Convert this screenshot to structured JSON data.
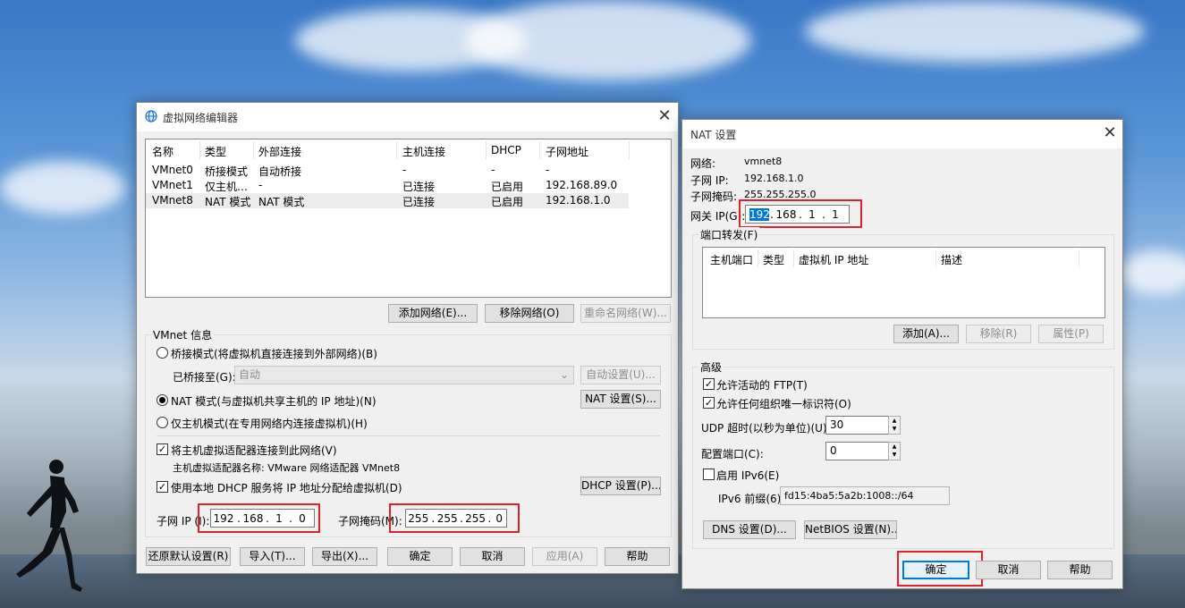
{
  "vne": {
    "title": "虚拟网络编辑器",
    "columns": [
      "名称",
      "类型",
      "外部连接",
      "主机连接",
      "DHCP",
      "子网地址"
    ],
    "rows": [
      [
        "VMnet0",
        "桥接模式",
        "自动桥接",
        "-",
        "-",
        "-"
      ],
      [
        "VMnet1",
        "仅主机…",
        "-",
        "已连接",
        "已启用",
        "192.168.89.0"
      ],
      [
        "VMnet8",
        "NAT 模式",
        "NAT 模式",
        "已连接",
        "已启用",
        "192.168.1.0"
      ]
    ],
    "add_network": "添加网络(E)...",
    "remove_network": "移除网络(O)",
    "rename_network": "重命名网络(W)...",
    "vmnet_info": "VMnet 信息",
    "bridged_mode": "桥接模式(将虚拟机直接连接到外部网络)(B)",
    "bridged_to_label": "已桥接至(G):",
    "bridged_to_value": "自动",
    "auto_settings": "自动设置(U)...",
    "nat_mode": "NAT 模式(与虚拟机共享主机的 IP 地址)(N)",
    "nat_settings": "NAT 设置(S)...",
    "host_only_mode": "仅主机模式(在专用网络内连接虚拟机)(H)",
    "connect_adapter": "将主机虚拟适配器连接到此网络(V)",
    "adapter_name": "主机虚拟适配器名称: VMware 网络适配器 VMnet8",
    "use_dhcp": "使用本地 DHCP 服务将 IP 地址分配给虚拟机(D)",
    "dhcp_settings": "DHCP 设置(P)...",
    "subnet_ip_label": "子网 IP (I):",
    "subnet_ip": [
      "192",
      "168",
      "1",
      "0"
    ],
    "subnet_mask_label": "子网掩码(M):",
    "subnet_mask": [
      "255",
      "255",
      "255",
      "0"
    ],
    "restore_defaults": "还原默认设置(R)",
    "import": "导入(T)...",
    "export": "导出(X)...",
    "ok": "确定",
    "cancel": "取消",
    "apply": "应用(A)",
    "help": "帮助"
  },
  "nat": {
    "title": "NAT 设置",
    "network_label": "网络:",
    "network_value": "vmnet8",
    "subnet_ip_label": "子网 IP:",
    "subnet_ip_value": "192.168.1.0",
    "subnet_mask_label": "子网掩码:",
    "subnet_mask_value": "255.255.255.0",
    "gateway_label": "网关 IP(G):",
    "gateway": [
      "192",
      "168",
      "1",
      "1"
    ],
    "port_forwarding": "端口转发(F)",
    "pf_columns": [
      "主机端口",
      "类型",
      "虚拟机 IP 地址",
      "描述"
    ],
    "add": "添加(A)...",
    "remove": "移除(R)",
    "properties": "属性(P)",
    "advanced": "高级",
    "allow_ftp": "允许活动的 FTP(T)",
    "allow_oui": "允许任何组织唯一标识符(O)",
    "udp_timeout_label": "UDP 超时(以秒为单位)(U):",
    "udp_timeout": "30",
    "config_port_label": "配置端口(C):",
    "config_port": "0",
    "enable_ipv6": "启用 IPv6(E)",
    "ipv6_prefix_label": "IPv6 前缀(6):",
    "ipv6_prefix": "fd15:4ba5:5a2b:1008::/64",
    "dns_settings": "DNS 设置(D)...",
    "netbios_settings": "NetBIOS 设置(N)...",
    "ok": "确定",
    "cancel": "取消",
    "help": "帮助"
  }
}
